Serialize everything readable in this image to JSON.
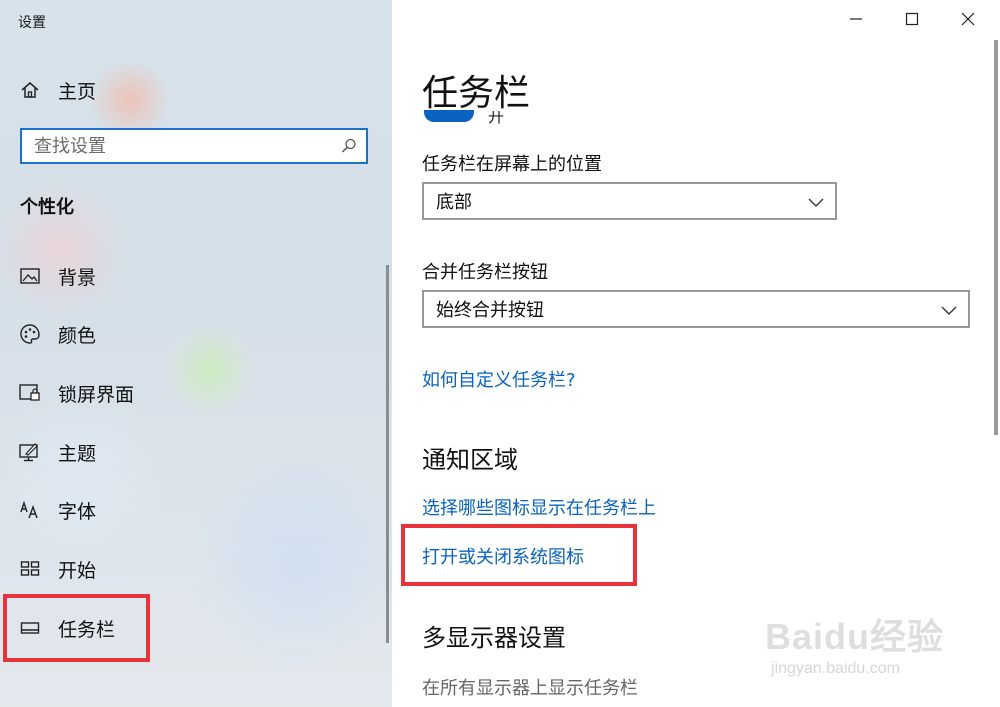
{
  "window": {
    "title": "设置",
    "controls": {
      "minimize_icon": "minimize-icon",
      "maximize_icon": "maximize-icon",
      "close_icon": "close-icon"
    }
  },
  "sidebar": {
    "home_label": "主页",
    "search_placeholder": "查找设置",
    "section_title": "个性化",
    "items": [
      {
        "label": "背景",
        "icon": "picture-icon"
      },
      {
        "label": "颜色",
        "icon": "palette-icon"
      },
      {
        "label": "锁屏界面",
        "icon": "lock-screen-icon"
      },
      {
        "label": "主题",
        "icon": "theme-brush-icon"
      },
      {
        "label": "字体",
        "icon": "font-icon"
      },
      {
        "label": "开始",
        "icon": "start-grid-icon"
      },
      {
        "label": "任务栏",
        "icon": "taskbar-icon",
        "selected": true
      }
    ]
  },
  "main": {
    "title": "任务栏",
    "toggle_partial_text": "开",
    "position_label": "任务栏在屏幕上的位置",
    "position_value": "底部",
    "combine_label": "合并任务栏按钮",
    "combine_value": "始终合并按钮",
    "customize_link": "如何自定义任务栏?",
    "notification_heading": "通知区域",
    "select_icons_link": "选择哪些图标显示在任务栏上",
    "system_icons_link": "打开或关闭系统图标",
    "multi_display_heading": "多显示器设置",
    "multi_display_toggle_label": "在所有显示器上显示任务栏"
  },
  "watermark": {
    "logo": "Baidu经验",
    "url": "jingyan.baidu.com"
  },
  "colors": {
    "accent": "#0a63c0",
    "highlight": "#e8333b"
  }
}
